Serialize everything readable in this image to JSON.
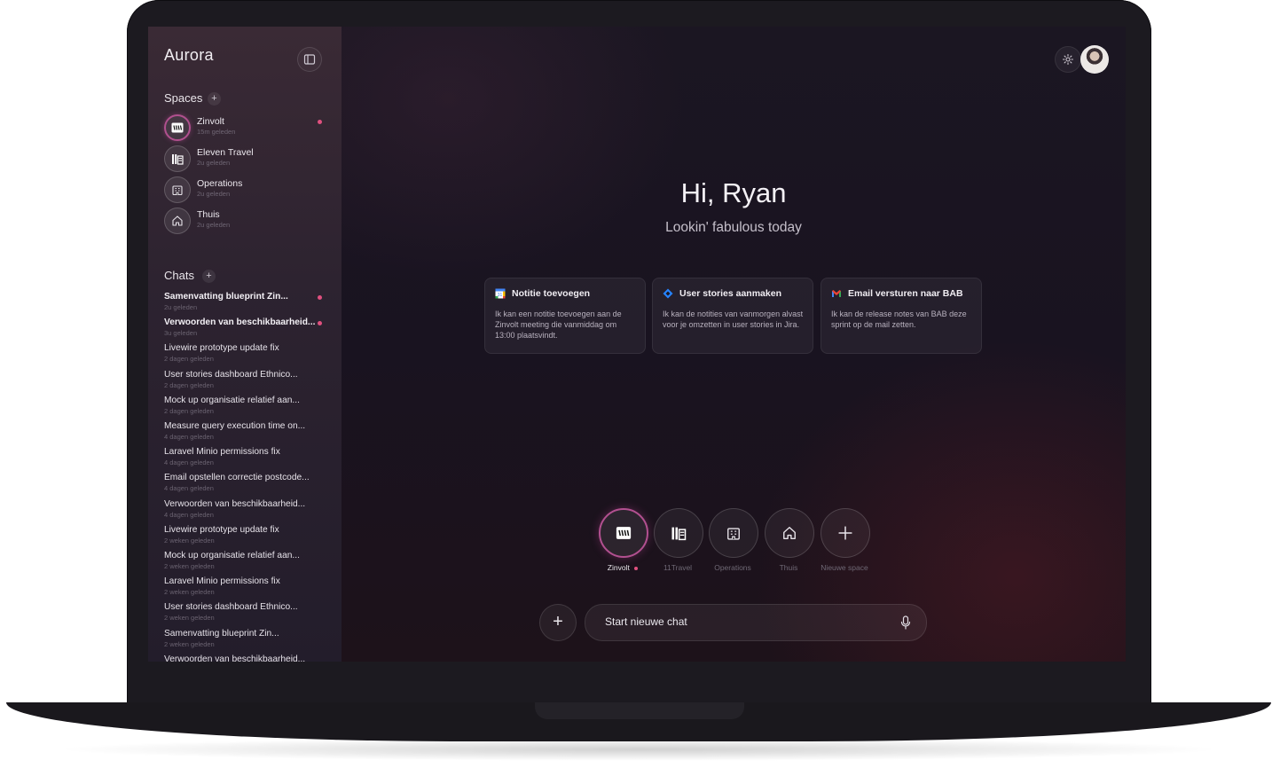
{
  "sidebar": {
    "brand": "Aurora",
    "spaces_title": "Spaces",
    "chats_title": "Chats",
    "add_glyph": "+",
    "spaces": [
      {
        "name": "Zinvolt",
        "time": "15m geleden",
        "icon": "zinvolt-logo-icon",
        "active": true,
        "unread": true
      },
      {
        "name": "Eleven Travel",
        "time": "2u geleden",
        "icon": "eleven-travel-logo-icon",
        "active": false,
        "unread": false
      },
      {
        "name": "Operations",
        "time": "2u geleden",
        "icon": "building-icon",
        "active": false,
        "unread": false
      },
      {
        "name": "Thuis",
        "time": "2u geleden",
        "icon": "home-icon",
        "active": false,
        "unread": false
      }
    ],
    "chats": [
      {
        "title": "Samenvatting blueprint Zin...",
        "time": "2u geleden",
        "bold": true,
        "unread": true
      },
      {
        "title": "Verwoorden van beschikbaarheid...",
        "time": "3u geleden",
        "bold": true,
        "unread": true
      },
      {
        "title": "Livewire prototype update fix",
        "time": "2 dagen geleden",
        "bold": false,
        "unread": false
      },
      {
        "title": "User stories dashboard Ethnico...",
        "time": "2 dagen geleden",
        "bold": false,
        "unread": false
      },
      {
        "title": "Mock up organisatie relatief aan...",
        "time": "2 dagen geleden",
        "bold": false,
        "unread": false
      },
      {
        "title": "Measure query execution time on...",
        "time": "4 dagen geleden",
        "bold": false,
        "unread": false
      },
      {
        "title": "Laravel Minio permissions fix",
        "time": "4 dagen geleden",
        "bold": false,
        "unread": false
      },
      {
        "title": "Email opstellen correctie postcode...",
        "time": "4 dagen geleden",
        "bold": false,
        "unread": false
      },
      {
        "title": "Verwoorden van beschikbaarheid...",
        "time": "4 dagen geleden",
        "bold": false,
        "unread": false
      },
      {
        "title": "Livewire prototype update fix",
        "time": "2 weken geleden",
        "bold": false,
        "unread": false
      },
      {
        "title": "Mock up organisatie relatief aan...",
        "time": "2 weken geleden",
        "bold": false,
        "unread": false
      },
      {
        "title": "Laravel Minio permissions fix",
        "time": "2 weken geleden",
        "bold": false,
        "unread": false
      },
      {
        "title": "User stories dashboard Ethnico...",
        "time": "2 weken geleden",
        "bold": false,
        "unread": false
      },
      {
        "title": "Samenvatting blueprint Zin...",
        "time": "2 weken geleden",
        "bold": false,
        "unread": false
      },
      {
        "title": "Verwoorden van beschikbaarheid...",
        "time": "",
        "bold": false,
        "unread": false
      }
    ]
  },
  "main": {
    "greeting": "Hi, Ryan",
    "subgreeting": "Lookin' fabulous today",
    "cards": [
      {
        "title": "Notitie toevoegen",
        "text": "Ik kan een notitie toevoegen aan de Zinvolt meeting die vanmiddag om 13:00 plaatsvindt.",
        "icon": "google-calendar-icon"
      },
      {
        "title": "User stories aanmaken",
        "text": "Ik kan de notities van vanmorgen alvast voor je omzetten in user stories in Jira.",
        "icon": "jira-icon"
      },
      {
        "title": "Email versturen naar BAB",
        "text": "Ik kan de release notes van BAB deze sprint op de mail zetten.",
        "icon": "gmail-icon"
      }
    ],
    "space_buttons": [
      {
        "label": "Zinvolt",
        "icon": "zinvolt-logo-icon",
        "active": true
      },
      {
        "label": "11Travel",
        "icon": "eleven-travel-logo-icon",
        "active": false
      },
      {
        "label": "Operations",
        "icon": "building-icon",
        "active": false
      },
      {
        "label": "Thuis",
        "icon": "home-icon",
        "active": false
      },
      {
        "label": "Nieuwe space",
        "icon": "plus-icon",
        "active": false
      }
    ],
    "add_glyph": "+",
    "chat_placeholder": "Start nieuwe chat"
  },
  "colors": {
    "accent": "#b0508e",
    "unread_dot": "#e0507f"
  }
}
